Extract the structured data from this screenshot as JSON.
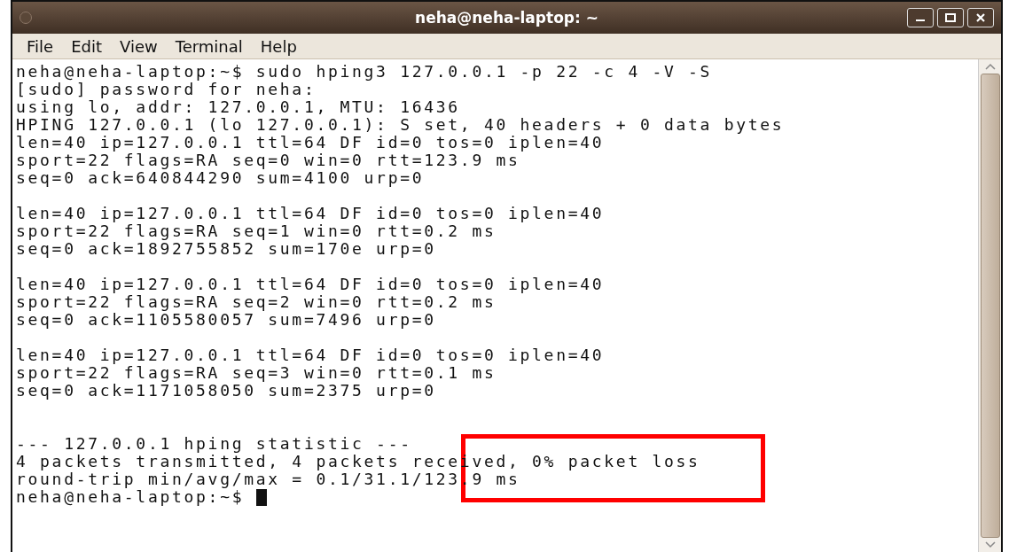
{
  "window": {
    "title": "neha@neha-laptop: ~"
  },
  "menu": [
    "File",
    "Edit",
    "View",
    "Terminal",
    "Help"
  ],
  "terminal": {
    "lines": [
      {
        "kind": "prompt",
        "text": "neha@neha-laptop:~$ sudo hping3 127.0.0.1 -p 22 -c 4 -V -S"
      },
      {
        "kind": "output",
        "text": "[sudo] password for neha:"
      },
      {
        "kind": "output",
        "text": "using lo, addr: 127.0.0.1, MTU: 16436"
      },
      {
        "kind": "output",
        "text": "HPING 127.0.0.1 (lo 127.0.0.1): S set, 40 headers + 0 data bytes"
      },
      {
        "kind": "output",
        "text": "len=40 ip=127.0.0.1 ttl=64 DF id=0 tos=0 iplen=40"
      },
      {
        "kind": "output",
        "text": "sport=22 flags=RA seq=0 win=0 rtt=123.9 ms"
      },
      {
        "kind": "output",
        "text": "seq=0 ack=640844290 sum=4100 urp=0"
      },
      {
        "kind": "blank"
      },
      {
        "kind": "output",
        "text": "len=40 ip=127.0.0.1 ttl=64 DF id=0 tos=0 iplen=40"
      },
      {
        "kind": "output",
        "text": "sport=22 flags=RA seq=1 win=0 rtt=0.2 ms"
      },
      {
        "kind": "output",
        "text": "seq=0 ack=1892755852 sum=170e urp=0"
      },
      {
        "kind": "blank"
      },
      {
        "kind": "output",
        "text": "len=40 ip=127.0.0.1 ttl=64 DF id=0 tos=0 iplen=40"
      },
      {
        "kind": "output",
        "text": "sport=22 flags=RA seq=2 win=0 rtt=0.2 ms"
      },
      {
        "kind": "output",
        "text": "seq=0 ack=1105580057 sum=7496 urp=0"
      },
      {
        "kind": "blank"
      },
      {
        "kind": "output",
        "text": "len=40 ip=127.0.0.1 ttl=64 DF id=0 tos=0 iplen=40"
      },
      {
        "kind": "output",
        "text": "sport=22 flags=RA seq=3 win=0 rtt=0.1 ms"
      },
      {
        "kind": "output",
        "text": "seq=0 ack=1171058050 sum=2375 urp=0"
      },
      {
        "kind": "blank"
      },
      {
        "kind": "blank"
      },
      {
        "kind": "output",
        "text": "--- 127.0.0.1 hping statistic ---"
      },
      {
        "kind": "output",
        "text": "4 packets transmitted, 4 packets received, 0% packet loss"
      },
      {
        "kind": "output",
        "text": "round-trip min/avg/max = 0.1/31.1/123.9 ms"
      },
      {
        "kind": "cursor",
        "text": "neha@neha-laptop:~$"
      }
    ]
  },
  "annotation": {
    "kind": "rectangle"
  }
}
